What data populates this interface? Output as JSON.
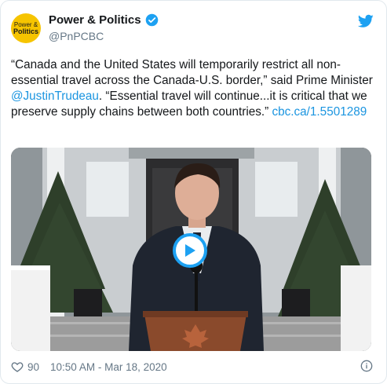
{
  "author": {
    "name": "Power & Politics",
    "handle": "@PnPCBC",
    "avatar_line1": "Power &",
    "avatar_line2": "Politics",
    "avatar_color": "#f6c400",
    "verified_icon": "verified-badge-icon"
  },
  "tweet": {
    "text_part1": "“Canada and the United States will temporarily restrict all non-essential travel across the Canada-U.S. border,” said Prime Minister ",
    "mention": "@JustinTrudeau",
    "text_part2": ". “Essential travel will continue...it is critical that we preserve supply chains between both countries.” ",
    "link": "cbc.ca/1.5501289"
  },
  "media": {
    "type": "video",
    "play_icon": "play-icon"
  },
  "footer": {
    "likes": "90",
    "timestamp": "10:50 AM - Mar 18, 2020",
    "heart_icon": "heart-icon",
    "info_icon": "info-icon"
  },
  "colors": {
    "link": "#1b95e0",
    "twitter_blue": "#1da1f2",
    "meta_gray": "#657786"
  }
}
